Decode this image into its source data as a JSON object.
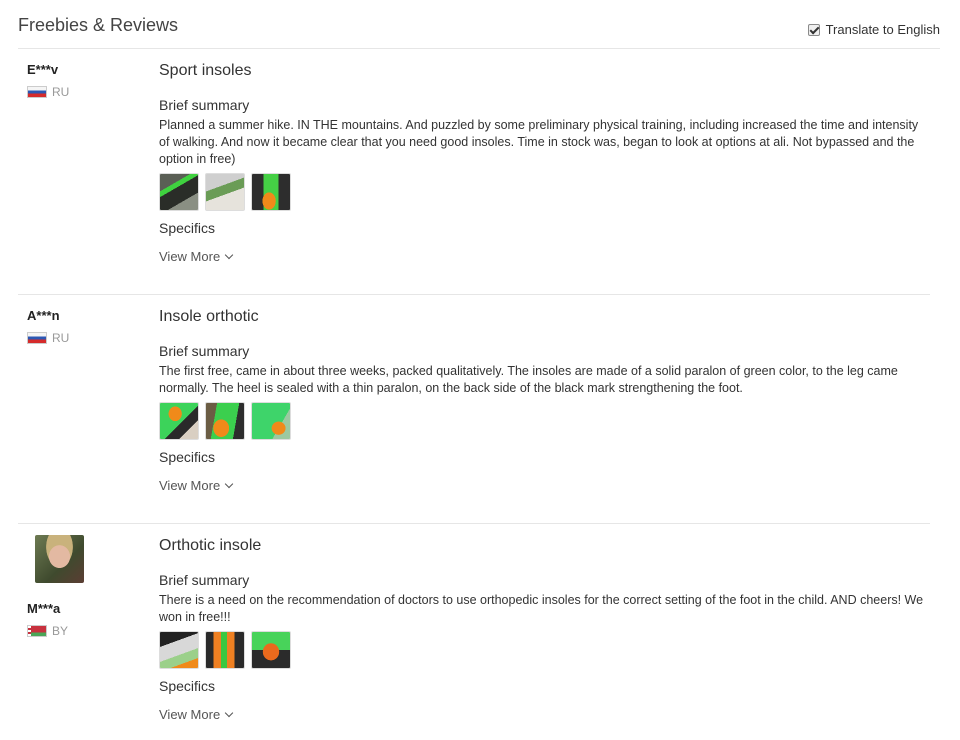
{
  "header": {
    "title": "Freebies & Reviews",
    "translate_label": "Translate to English",
    "translate_checked": true
  },
  "reviews": [
    {
      "username": "E***v",
      "country": "RU",
      "title": "Sport insoles",
      "summary_label": "Brief summary",
      "summary": "Planned a summer hike. IN THE mountains. And puzzled by some preliminary physical training, including increased the time and intensity of walking. And now it became clear that you need good insoles. Time in stock was, began to look at options at ali. Not bypassed and the option in free)",
      "specifics_label": "Specifics",
      "view_more": "View More"
    },
    {
      "username": "A***n",
      "country": "RU",
      "title": "Insole orthotic",
      "summary_label": "Brief summary",
      "summary": "The first free, came in about three weeks, packed qualitatively. The insoles are made of a solid paralon of green color, to the leg came normally. The heel is sealed with a thin paralon, on the back side of the black mark strengthening the foot.",
      "specifics_label": "Specifics",
      "view_more": "View More"
    },
    {
      "username": "M***a",
      "country": "BY",
      "title": "Orthotic insole",
      "summary_label": "Brief summary",
      "summary": "There is a need on the recommendation of doctors to use orthopedic insoles for the correct setting of the foot in the child. AND cheers! We won in free!!!",
      "specifics_label": "Specifics",
      "view_more": "View More"
    }
  ],
  "colors": {
    "border": "#e6e6e6",
    "text": "#333333",
    "muted": "#999999"
  }
}
